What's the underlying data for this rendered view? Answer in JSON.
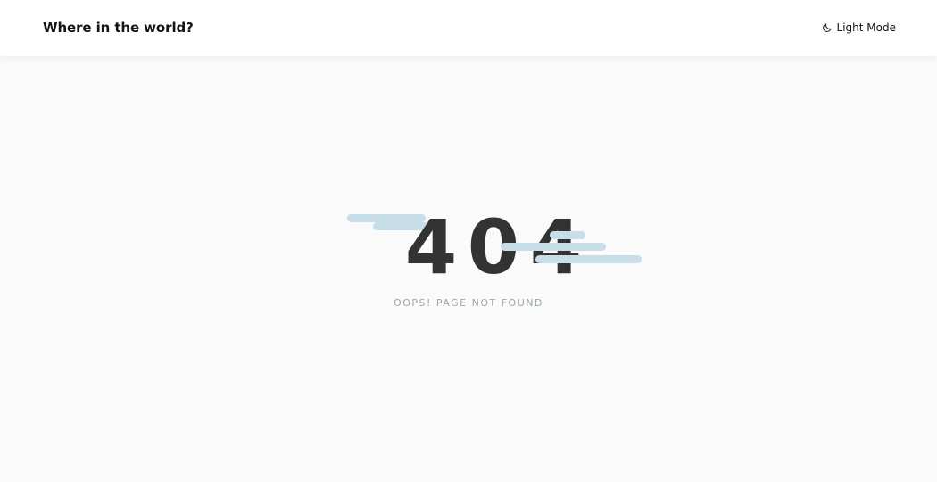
{
  "header": {
    "title": "Where in the world?",
    "mode_toggle": {
      "icon": "moon-icon",
      "label": "Light Mode"
    }
  },
  "main": {
    "error_code_digits": [
      "4",
      "0",
      "4"
    ],
    "message": "OOPS! PAGE NOT FOUND"
  },
  "colors": {
    "header_bg": "#ffffff",
    "page_bg": "#fafafa",
    "text": "#111517",
    "error_code": "#333333",
    "cloud": "#c7dde8",
    "message": "#9aa7b0"
  }
}
